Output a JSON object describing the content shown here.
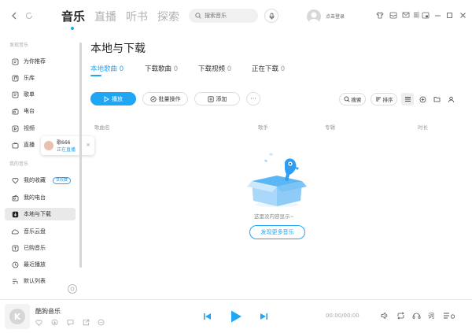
{
  "topbar": {
    "tabs": [
      {
        "label": "音乐",
        "active": true
      },
      {
        "label": "直播",
        "active": false
      },
      {
        "label": "听书",
        "active": false
      },
      {
        "label": "探索",
        "active": false
      }
    ],
    "search_placeholder": "搜索音乐",
    "login_label": "点击登录"
  },
  "sidebar": {
    "section_discover": "发现音乐",
    "discover_items": [
      {
        "label": "为你推荐",
        "icon": "recommend-icon"
      },
      {
        "label": "乐库",
        "icon": "library-icon"
      },
      {
        "label": "歌单",
        "icon": "playlist-icon"
      },
      {
        "label": "电台",
        "icon": "radio-icon"
      },
      {
        "label": "视频",
        "icon": "video-icon"
      },
      {
        "label": "直播",
        "icon": "live-icon"
      }
    ],
    "section_mine": "我的音乐",
    "mine_items": [
      {
        "label": "我的收藏",
        "icon": "heart-icon",
        "badge": "享收藏"
      },
      {
        "label": "我的电台",
        "icon": "radio-icon"
      },
      {
        "label": "本地与下载",
        "icon": "download-icon",
        "active": true
      },
      {
        "label": "音乐云盘",
        "icon": "cloud-icon"
      },
      {
        "label": "已购音乐",
        "icon": "purchased-icon"
      },
      {
        "label": "最近播放",
        "icon": "history-icon"
      },
      {
        "label": "默认列表",
        "icon": "list-icon"
      }
    ],
    "live_popup": {
      "name": "歌666",
      "status": "正在直播",
      "close": "×"
    }
  },
  "content": {
    "title": "本地与下载",
    "subtabs": [
      {
        "label": "本地歌曲",
        "count": "0",
        "active": true
      },
      {
        "label": "下载歌曲",
        "count": "0",
        "active": false
      },
      {
        "label": "下载视频",
        "count": "0",
        "active": false
      },
      {
        "label": "正在下载",
        "count": "0",
        "active": false
      }
    ],
    "toolbar": {
      "play": "播放",
      "batch": "批量操作",
      "add": "添加",
      "more": "···",
      "search": "搜索",
      "sort": "排序"
    },
    "columns": [
      "歌曲名",
      "歌手",
      "专辑",
      "时长"
    ],
    "empty_text": "这里没内容显示~",
    "discover_button": "发现更多音乐"
  },
  "player": {
    "song": "酷狗音乐",
    "time": "00:00/00:00",
    "lyrics": "词",
    "cover_letter": "K",
    "accent": "#1fa6f5"
  }
}
